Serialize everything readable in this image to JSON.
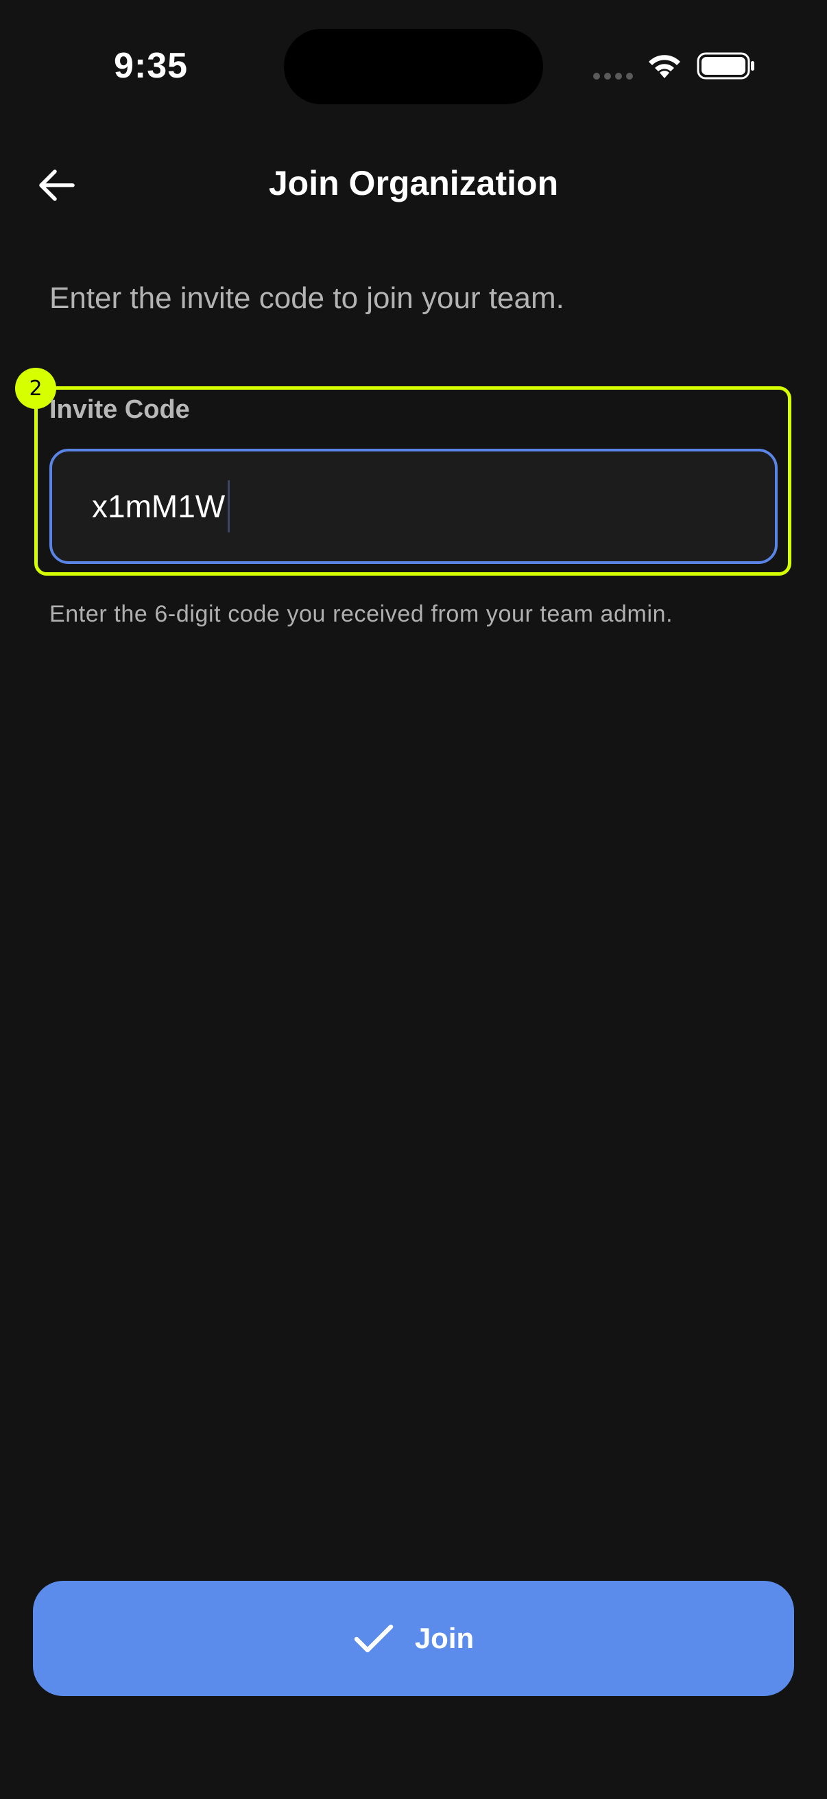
{
  "status_bar": {
    "time": "9:35",
    "signal_icon": "cellular-signal-icon",
    "wifi_icon": "wifi-icon",
    "battery_icon": "battery-icon"
  },
  "header": {
    "back_icon": "arrow-left-icon",
    "title": "Join Organization"
  },
  "subtitle": "Enter the invite code to join your team.",
  "invite_code": {
    "label": "Invite Code",
    "value": "x1mM1W",
    "helper": "Enter the 6-digit code you received from your team admin.",
    "highlight_marker": "2"
  },
  "join_button": {
    "icon": "checkmark-icon",
    "label": "Join"
  },
  "colors": {
    "background": "#131313",
    "accent": "#5b8cec",
    "input_border": "#5a85e6",
    "highlight": "#d6ff00"
  }
}
